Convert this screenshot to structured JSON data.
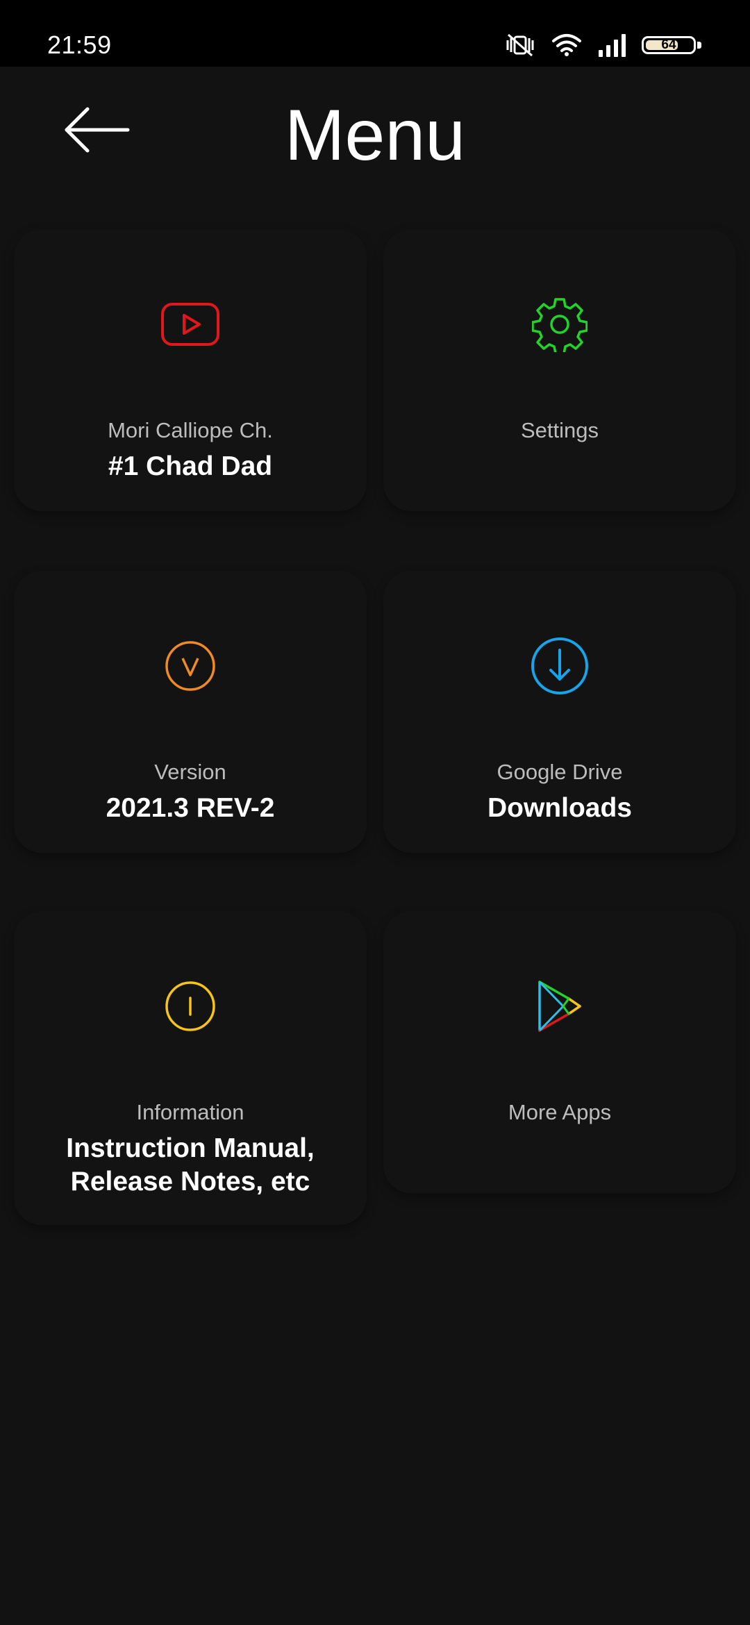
{
  "status_bar": {
    "time": "21:59",
    "battery_level": "64",
    "icons": [
      "vibrate-off-icon",
      "wifi-icon",
      "signal-icon",
      "battery-icon"
    ]
  },
  "header": {
    "title": "Menu",
    "back_icon": "arrow-left-icon"
  },
  "menu": {
    "items": [
      {
        "label": "Mori Calliope Ch.",
        "value": "#1 Chad Dad",
        "icon": "youtube-icon",
        "color": "#e0171b"
      },
      {
        "label": "Settings",
        "value": "",
        "icon": "gear-icon",
        "color": "#22d42a"
      },
      {
        "label": "Version",
        "value": "2021.3 REV-2",
        "icon": "version-v-icon",
        "color": "#f08a24"
      },
      {
        "label": "Google Drive",
        "value": "Downloads",
        "icon": "download-icon",
        "color": "#1aa3e8"
      },
      {
        "label": "Information",
        "value": "Instruction Manual,\nRelease Notes, etc",
        "icon": "info-icon",
        "color": "#f5c518"
      },
      {
        "label": "More Apps",
        "value": "",
        "icon": "play-store-icon",
        "color": "#2bc0e8"
      }
    ]
  },
  "colors": {
    "background": "#121212",
    "status_bar": "#000000",
    "label_text": "#bdbdbd",
    "value_text": "#ffffff"
  }
}
